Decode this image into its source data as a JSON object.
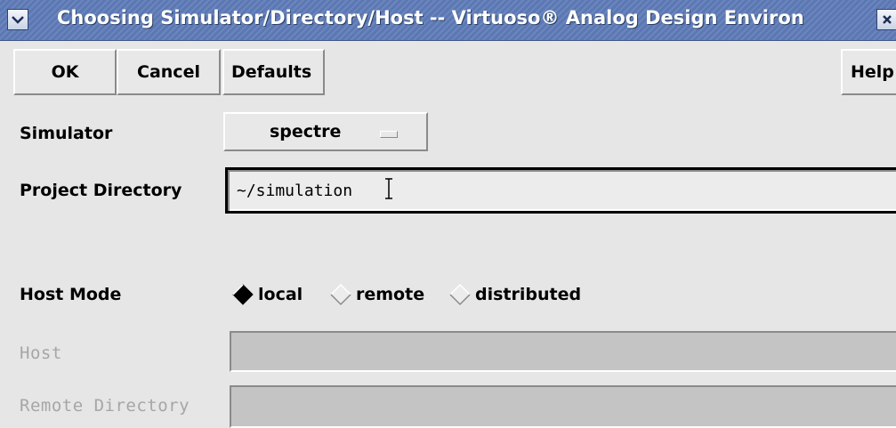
{
  "window": {
    "title": "Choosing Simulator/Directory/Host -- Virtuoso® Analog Design Environ"
  },
  "toolbar": {
    "ok_label": "OK",
    "cancel_label": "Cancel",
    "defaults_label": "Defaults",
    "help_label": "Help"
  },
  "form": {
    "simulator_label": "Simulator",
    "simulator_value": "spectre",
    "project_dir_label": "Project Directory",
    "project_dir_value": "~/simulation",
    "host_mode_label": "Host Mode",
    "host_modes": [
      {
        "label": "local",
        "selected": true
      },
      {
        "label": "remote",
        "selected": false
      },
      {
        "label": "distributed",
        "selected": false
      }
    ],
    "host_label": "Host",
    "host_value": "",
    "remote_dir_label": "Remote Directory",
    "remote_dir_value": ""
  },
  "icons": {
    "window_menu": "chevron-down-icon",
    "window_close": "close-icon",
    "cyclic_indicator": "cyclic-menu-icon",
    "radio_selected": "diamond-filled-icon",
    "radio_unselected": "diamond-empty-icon",
    "text_cursor": "ibeam-cursor-icon"
  },
  "colors": {
    "titlebar": "#5b78b4",
    "background": "#e6e6e6",
    "disabled_field": "#c4c4c4",
    "disabled_text": "#a6a6a6"
  }
}
